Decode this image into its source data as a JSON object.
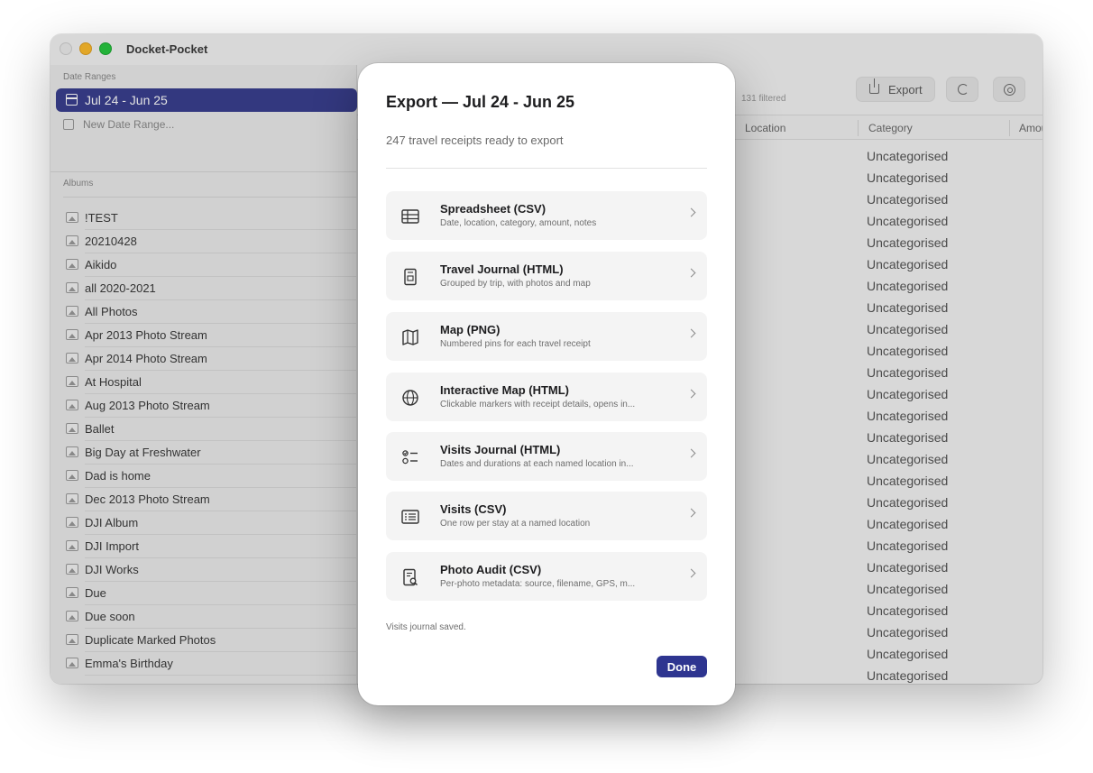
{
  "window": {
    "title": "Docket-Pocket"
  },
  "sidebar": {
    "date_ranges_label": "Date Ranges",
    "selected_range": "Jul 24 - Jun 25",
    "new_range": "New Date Range...",
    "albums_label": "Albums",
    "albums": [
      "!TEST",
      "20210428",
      "Aikido",
      "all 2020-2021",
      "All Photos",
      "Apr 2013 Photo Stream",
      "Apr 2014 Photo Stream",
      "At Hospital",
      "Aug 2013 Photo Stream",
      "Ballet",
      "Big Day at Freshwater",
      "Dad is home",
      "Dec 2013 Photo Stream",
      "DJI Album",
      "DJI Import",
      "DJI Works",
      "Due",
      "Due soon",
      "Duplicate Marked Photos",
      "Emma's Birthday"
    ]
  },
  "toolbar": {
    "filtered": "131 filtered",
    "export_label": "Export"
  },
  "table": {
    "columns": [
      "Location",
      "Category",
      "Amou"
    ],
    "category_values": [
      "Uncategorised",
      "Uncategorised",
      "Uncategorised",
      "Uncategorised",
      "Uncategorised",
      "Uncategorised",
      "Uncategorised",
      "Uncategorised",
      "Uncategorised",
      "Uncategorised",
      "Uncategorised",
      "Uncategorised",
      "Uncategorised",
      "Uncategorised",
      "Uncategorised",
      "Uncategorised",
      "Uncategorised",
      "Uncategorised",
      "Uncategorised",
      "Uncategorised",
      "Uncategorised",
      "Uncategorised",
      "Uncategorised",
      "Uncategorised",
      "Uncategorised"
    ]
  },
  "modal": {
    "title": "Export — Jul 24 - Jun 25",
    "subtitle": "247 travel receipts ready to export",
    "options": [
      {
        "title": "Spreadsheet (CSV)",
        "desc": "Date, location, category, amount, notes",
        "icon": "table-icon"
      },
      {
        "title": "Travel Journal (HTML)",
        "desc": "Grouped by trip, with photos and map",
        "icon": "journal-icon"
      },
      {
        "title": "Map (PNG)",
        "desc": "Numbered pins for each travel receipt",
        "icon": "map-icon"
      },
      {
        "title": "Interactive Map (HTML)",
        "desc": "Clickable markers with receipt details, opens in...",
        "icon": "globe-icon"
      },
      {
        "title": "Visits Journal (HTML)",
        "desc": "Dates and durations at each named location in...",
        "icon": "checklist-icon"
      },
      {
        "title": "Visits (CSV)",
        "desc": "One row per stay at a named location",
        "icon": "list-icon"
      },
      {
        "title": "Photo Audit (CSV)",
        "desc": "Per-photo metadata: source, filename, GPS, m...",
        "icon": "document-search-icon"
      }
    ],
    "status": "Visits journal saved.",
    "done_label": "Done"
  },
  "colors": {
    "accent": "#2e3590",
    "selection": "#3a3f8f"
  }
}
